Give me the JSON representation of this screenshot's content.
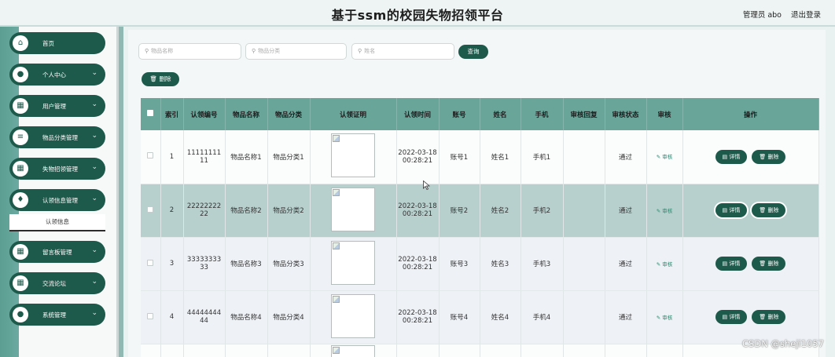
{
  "header": {
    "title": "基于ssm的校园失物招领平台",
    "admin": "管理员 abo",
    "logout": "退出登录"
  },
  "sidebar": {
    "items": [
      {
        "label": "首页",
        "icon": "home-icon",
        "glyph": "⌂",
        "chevron": false
      },
      {
        "label": "个人中心",
        "icon": "user-icon",
        "glyph": "●",
        "chevron": true
      },
      {
        "label": "用户管理",
        "icon": "grid-icon",
        "glyph": "▦",
        "chevron": true
      },
      {
        "label": "物品分类管理",
        "icon": "list-icon",
        "glyph": "≡",
        "chevron": true
      },
      {
        "label": "失物招领管理",
        "icon": "grid-icon",
        "glyph": "▦",
        "chevron": true
      },
      {
        "label": "认领信息管理",
        "icon": "thumb-icon",
        "glyph": "♦",
        "chevron": true
      },
      {
        "label": "留言板管理",
        "icon": "grid-icon",
        "glyph": "▦",
        "chevron": true
      },
      {
        "label": "交流论坛",
        "icon": "grid-icon",
        "glyph": "▦",
        "chevron": true
      },
      {
        "label": "系统管理",
        "icon": "person-icon",
        "glyph": "●",
        "chevron": true
      }
    ],
    "submenu": "认领信息"
  },
  "search": {
    "name_placeholder": "物品名称",
    "category_placeholder": "物品分类",
    "person_placeholder": "姓名",
    "query_label": "查询"
  },
  "toolbar": {
    "delete_label": "删除"
  },
  "table": {
    "headers": [
      "索引",
      "认领编号",
      "物品名称",
      "物品分类",
      "认领证明",
      "认领时间",
      "账号",
      "姓名",
      "手机",
      "审核回复",
      "审核状态",
      "审核",
      "操作"
    ],
    "rows": [
      {
        "index": "1",
        "code": "11111111 11",
        "name": "物品名称1",
        "category": "物品分类1",
        "time": "2022-03-18 00:28:21",
        "account": "账号1",
        "person": "姓名1",
        "phone": "手机1",
        "reply": "",
        "status": "通过",
        "audit": "审核"
      },
      {
        "index": "2",
        "code": "22222222 22",
        "name": "物品名称2",
        "category": "物品分类2",
        "time": "2022-03-18 00:28:21",
        "account": "账号2",
        "person": "姓名2",
        "phone": "手机2",
        "reply": "",
        "status": "通过",
        "audit": "审核"
      },
      {
        "index": "3",
        "code": "33333333 33",
        "name": "物品名称3",
        "category": "物品分类3",
        "time": "2022-03-18 00:28:21",
        "account": "账号3",
        "person": "姓名3",
        "phone": "手机3",
        "reply": "",
        "status": "通过",
        "audit": "审核"
      },
      {
        "index": "4",
        "code": "44444444 44",
        "name": "物品名称4",
        "category": "物品分类4",
        "time": "2022-03-18 00:28:21",
        "account": "账号4",
        "person": "姓名4",
        "phone": "手机4",
        "reply": "",
        "status": "通过",
        "audit": "审核"
      }
    ],
    "detail_label": "详情",
    "row_delete_label": "删除"
  },
  "watermark": "CSDN @sheji1057",
  "colors": {
    "primary": "#1e5a4b",
    "header_row": "#6aa59a",
    "selected_row": "#b7d0cd"
  }
}
